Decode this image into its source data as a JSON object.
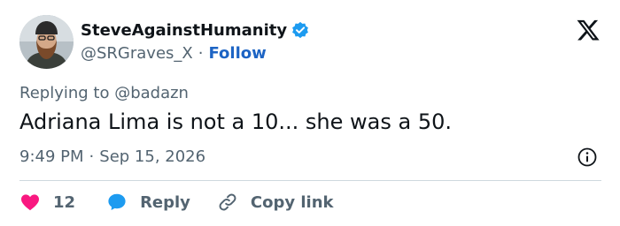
{
  "author": {
    "display_name": "SteveAgainstHumanity",
    "handle": "@SRGraves_X",
    "separator": "·",
    "follow_label": "Follow",
    "verified": true
  },
  "reply_to": "Replying to @badazn",
  "tweet": {
    "text": "Adriana Lima is not a 10... she was a 50.",
    "time": "9:49 PM",
    "separator": "·",
    "date": "Sep 15, 2026"
  },
  "actions": {
    "like_count": "12",
    "reply_label": "Reply",
    "copy_label": "Copy link"
  },
  "colors": {
    "like": "#f91880",
    "reply": "#1d9bf0",
    "follow": "#1d64c4",
    "verified": "#1d9bf0",
    "muted": "#536471"
  },
  "icons": {
    "logo": "x-logo-icon",
    "verified": "verified-badge-icon",
    "info": "info-icon",
    "like": "heart-icon",
    "reply": "speech-bubble-icon",
    "copy": "link-icon"
  }
}
